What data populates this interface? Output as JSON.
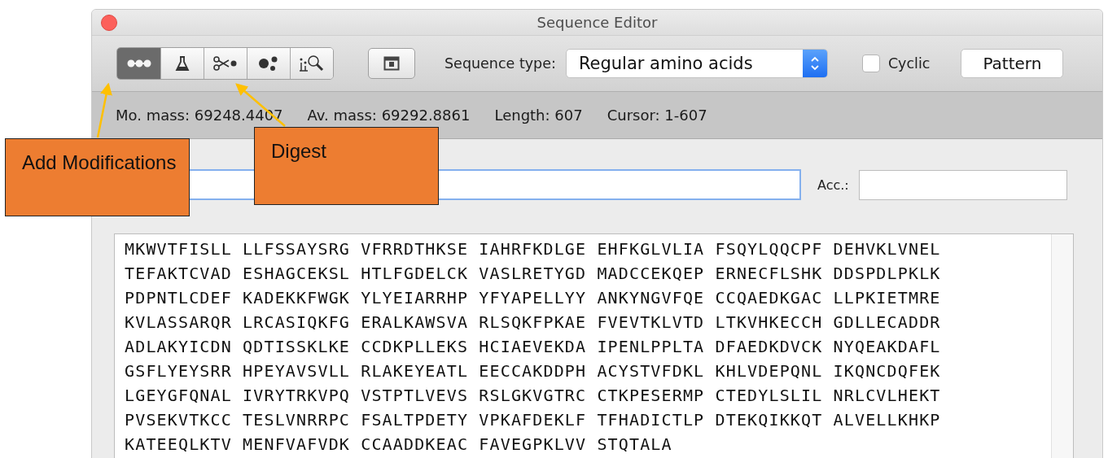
{
  "window": {
    "title": "Sequence Editor"
  },
  "toolbar": {
    "tools": [
      {
        "kind": "chain",
        "selected": true
      },
      {
        "kind": "flask",
        "selected": false
      },
      {
        "kind": "scissors",
        "selected": false
      },
      {
        "kind": "dots",
        "selected": false
      },
      {
        "kind": "search",
        "selected": false
      }
    ],
    "sequence_type": {
      "label": "Sequence type:",
      "value": "Regular amino acids"
    },
    "cyclic": {
      "label": "Cyclic",
      "checked": false
    },
    "pattern_button": "Pattern"
  },
  "stats": [
    "Mo. mass: 69248.4407",
    "Av. mass: 69292.8861",
    "Length: 607",
    "Cursor: 1-607"
  ],
  "acc": {
    "label": "Acc.:"
  },
  "sequence": [
    "MKWVTFISLL LLFSSAYSRG VFRRDTHKSE IAHRFKDLGE EHFKGLVLIA FSQYLQQCPF DEHVKLVNEL",
    "TEFAKTCVAD ESHAGCEKSL HTLFGDELCK VASLRETYGD MADCCEKQEP ERNECFLSHK DDSPDLPKLK",
    "PDPNTLCDEF KADEKKFWGK YLYEIARRHP YFYAPELLYY ANKYNGVFQE CCQAEDKGAC LLPKIETMRE",
    "KVLASSARQR LRCASIQKFG ERALKAWSVA RLSQKFPKAE FVEVTKLVTD LTKVHKECCH GDLLECADDR",
    "ADLAKYICDN QDTISSKLKE CCDKPLLEKS HCIAEVEKDA IPENLPPLTA DFAEDKDVCK NYQEAKDAFL",
    "GSFLYEYSRR HPEYAVSVLL RLAKEYEATL EECCAKDDPH ACYSTVFDKL KHLVDEPQNL IKQNCDQFEK",
    "LGEYGFQNAL IVRYTRKVPQ VSTPTLVEVS RSLGKVGTRC CTKPESERMP CTEDYLSLIL NRLCVLHEKT",
    "PVSEKVTKCC TESLVNRRPC FSALTPDETY VPKAFDEKLF TFHADICTLP DTEKQIKKQT ALVELLKHKP",
    "KATEEQLKTV MENFVAFVDK CCAADDKEAC FAVEGPKLVV STQTALA"
  ],
  "callouts": [
    "Add Modifications",
    "Digest"
  ]
}
